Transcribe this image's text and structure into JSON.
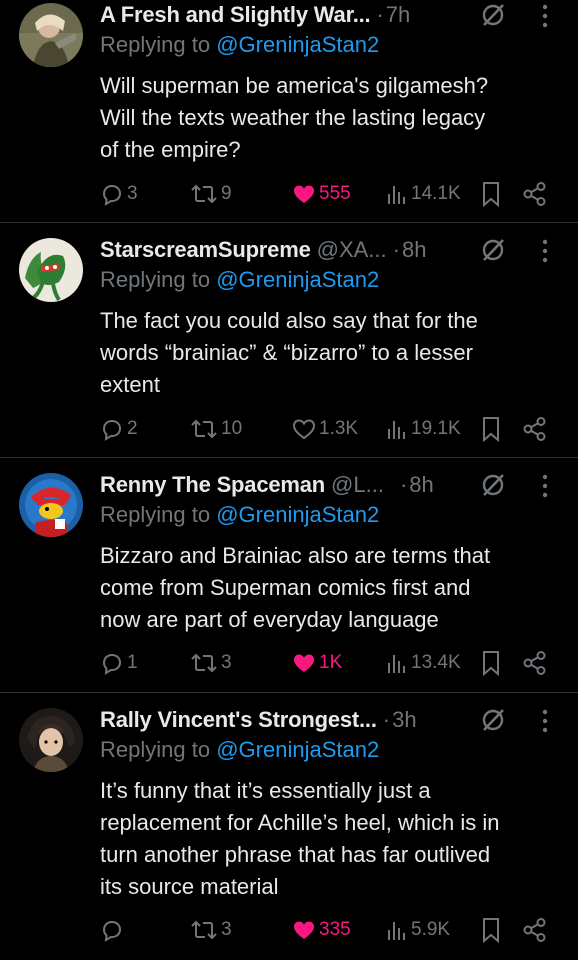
{
  "reply_prefix": "Replying to",
  "colors": {
    "background": "#000000",
    "text": "#e7e9ea",
    "muted": "#71767b",
    "mention": "#1d9bf0",
    "like_active": "#f91880",
    "divider": "#2f3336"
  },
  "icons": {
    "reply": "reply-icon",
    "retweet": "retweet-icon",
    "like": "heart-icon",
    "views": "views-chart-icon",
    "bookmark": "bookmark-icon",
    "share": "share-icon",
    "grok": "grok-icon",
    "more": "more-options-icon"
  },
  "tweets": [
    {
      "author_name": "A Fresh and Slightly War...",
      "handle": "",
      "dot": "·",
      "time": "7h",
      "reply_to": "@GreninjaStan2",
      "lines": [
        "Will superman be america's gilgamesh?",
        "Will the texts weather the lasting legacy",
        "of the empire?"
      ],
      "replies": "3",
      "retweets": "9",
      "likes": "555",
      "liked": true,
      "views": "14.1K"
    },
    {
      "author_name": "StarscreamSupreme",
      "handle": "@XA...",
      "dot": "·",
      "time": "8h",
      "reply_to": "@GreninjaStan2",
      "lines": [
        "The fact you could also say that for the",
        "words “brainiac” & “bizarro” to a lesser",
        "extent"
      ],
      "replies": "2",
      "retweets": "10",
      "likes": "1.3K",
      "liked": false,
      "views": "19.1K"
    },
    {
      "author_name": "Renny The Spaceman",
      "handle": "@L...",
      "dot": "·",
      "time": "8h",
      "reply_to": "@GreninjaStan2",
      "lines": [
        "Bizzaro and Brainiac also are terms that",
        "come from Superman comics first and",
        "now are part of everyday language"
      ],
      "replies": "1",
      "retweets": "3",
      "likes": "1K",
      "liked": true,
      "views": "13.4K"
    },
    {
      "author_name": "Rally Vincent's Strongest...",
      "handle": "",
      "dot": "·",
      "time": "3h",
      "reply_to": "@GreninjaStan2",
      "lines": [
        "It’s funny that it’s essentially just a",
        "replacement for Achille’s heel, which is in",
        "turn another phrase that has far outlived",
        "its source material"
      ],
      "replies": "",
      "retweets": "3",
      "likes": "335",
      "liked": true,
      "views": "5.9K"
    }
  ]
}
